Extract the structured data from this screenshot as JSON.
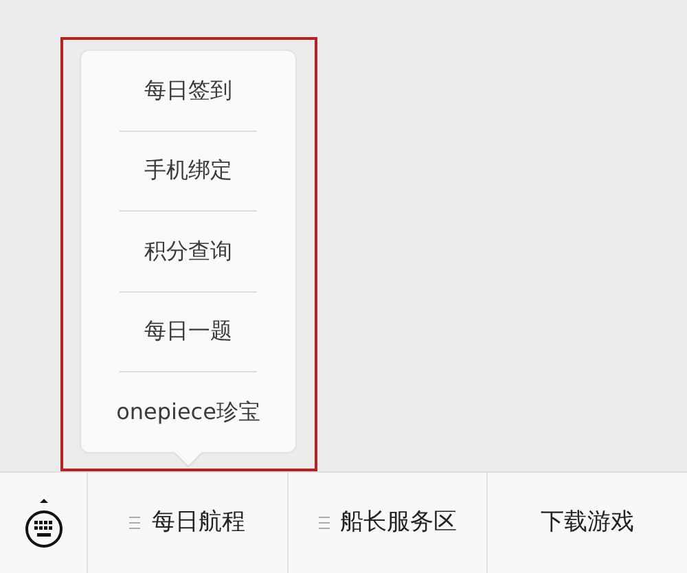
{
  "popup_menu": {
    "items": [
      {
        "label": "每日签到"
      },
      {
        "label": "手机绑定"
      },
      {
        "label": "积分查询"
      },
      {
        "label": "每日一题"
      },
      {
        "label": "onepiece珍宝"
      }
    ],
    "highlighted": true
  },
  "bottom_bar": {
    "menus": [
      {
        "label": "每日航程",
        "submenu_icon": true
      },
      {
        "label": "船长服务区",
        "submenu_icon": true
      },
      {
        "label": "下载游戏",
        "submenu_icon": false
      }
    ]
  }
}
